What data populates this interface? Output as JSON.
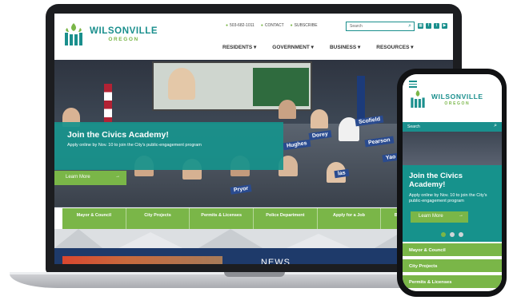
{
  "site": {
    "name": "WILSONVILLE",
    "sub": "OREGON"
  },
  "utility": {
    "phone": "503-682-1011",
    "contact": "CONTACT",
    "subscribe": "SUBSCRIBE"
  },
  "search": {
    "placeholder": "Search"
  },
  "nav": [
    "RESIDENTS",
    "GOVERNMENT",
    "BUSINESS",
    "RESOURCES"
  ],
  "hero": {
    "title": "Join the Civics Academy!",
    "body": "Apply online by Nov. 10 to join the City's public-engagement program",
    "button": "Learn More"
  },
  "signs": [
    "Scofield",
    "Hughes",
    "Dorey",
    "Pearson",
    "Yao",
    "Pryor",
    "las"
  ],
  "quick_links": [
    "Mayor & Council",
    "City Projects",
    "Permits & Licenses",
    "Police Department",
    "Apply for a Job",
    "Bids & Proposals"
  ],
  "news": {
    "title": "NEWS"
  },
  "phone": {
    "hero_title": "Join the Civics Academy!",
    "hero_body": "Apply online by Nov. 10 to join the City's public-engagement program",
    "button": "Learn More",
    "list": [
      "Mayor & Council",
      "City Projects",
      "Permits & Licenses"
    ]
  },
  "colors": {
    "teal": "#16928c",
    "green": "#7ab648",
    "navy": "#1e3a6a"
  }
}
